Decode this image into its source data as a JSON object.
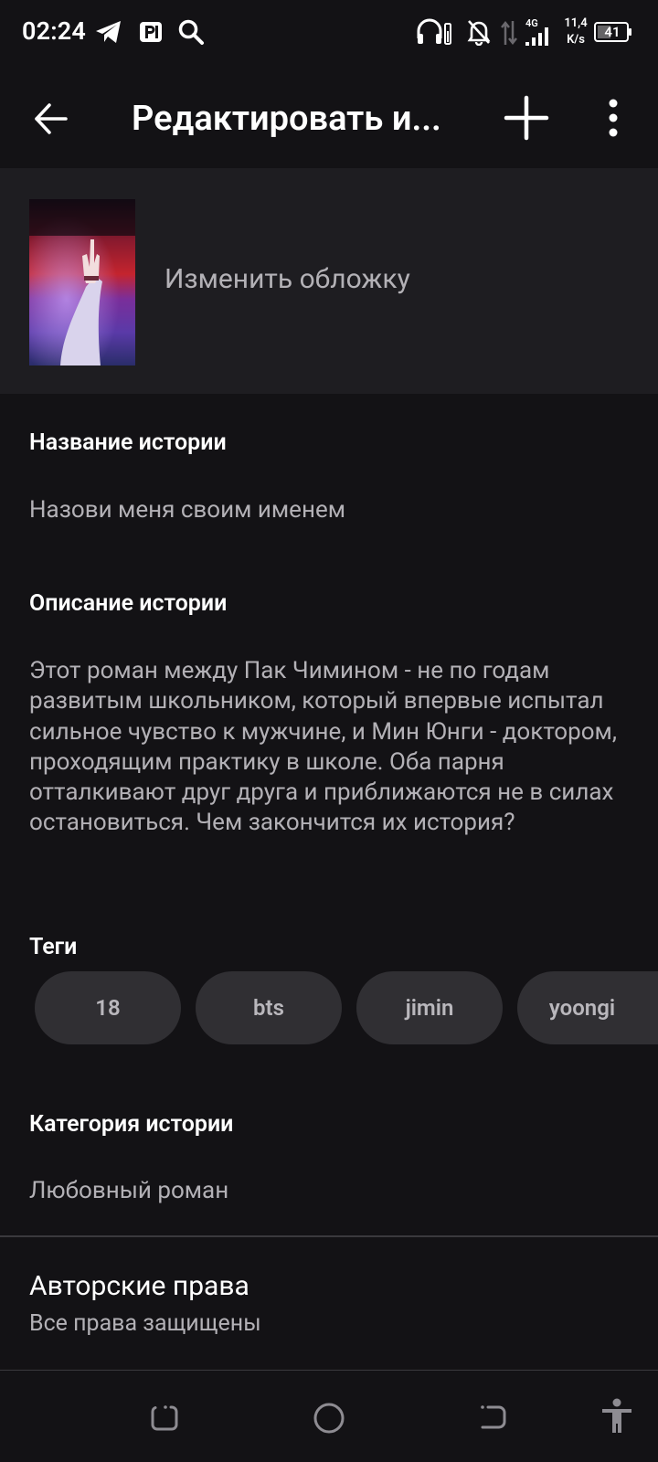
{
  "status_bar": {
    "time": "02:24",
    "icons": [
      "telegram-icon",
      "parking-app-icon",
      "search-icon",
      "headphones-icon",
      "bell-off-icon",
      "data-arrows-icon",
      "signal-4g-icon",
      "battery-icon"
    ],
    "network_type": "4G",
    "speed_value": "11,4",
    "speed_unit": "K/s",
    "battery": "41"
  },
  "app_bar": {
    "title": "Редактировать и...",
    "icons": [
      "back-arrow-icon",
      "plus-icon",
      "more-vert-icon"
    ]
  },
  "cover": {
    "label": "Изменить обложку"
  },
  "story": {
    "title_label": "Название истории",
    "title_value": "Назови меня своим именем",
    "description_label": "Описание истории",
    "description_value": "Этот роман между Пак Чимином - не по годам развитым школьником, который впервые испытал сильное чувство к мужчине, и Мин Юнги - доктором, проходящим практику в школе. Оба парня отталкивают друг друга и приближаются не в силах остановиться. Чем закончится их история?",
    "tags_label": "Теги",
    "tags": [
      "18",
      "bts",
      "jimin",
      "yoongi"
    ],
    "category_label": "Категория истории",
    "category_value": "Любовный роман",
    "copyright_label": "Авторские права",
    "copyright_value": "Все права защищены"
  },
  "nav_bar": {
    "icons": [
      "recents-icon",
      "home-icon",
      "back-icon",
      "accessibility-icon"
    ]
  },
  "colors": {
    "background": "#131215",
    "cover_section": "#1e1d21",
    "tag_background": "#302f33",
    "secondary_text": "#b3b1b6",
    "divider": "#3a393d"
  }
}
